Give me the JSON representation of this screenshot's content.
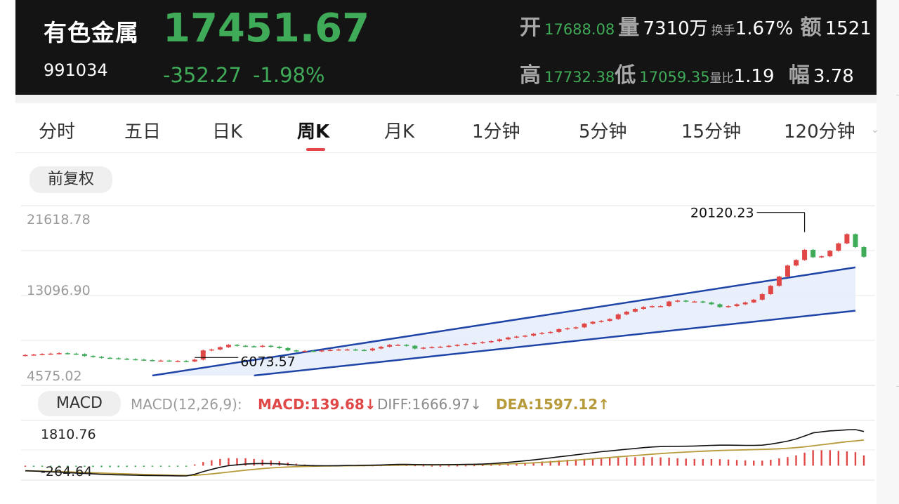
{
  "header": {
    "name": "有色金属",
    "code": "991034",
    "price": "17451.67",
    "change": "-352.27",
    "change_pct": "-1.98%",
    "open_label": "开",
    "open": "17688.08",
    "volume_label": "量",
    "volume": "7310万",
    "turnover_label": "换手",
    "turnover": "1.67%",
    "amount_label": "额",
    "amount": "1521",
    "high_label": "高",
    "high": "17732.38",
    "low_label": "低",
    "low": "17059.35",
    "vol_ratio_label": "量比",
    "vol_ratio": "1.19",
    "amplitude_label": "幅",
    "amplitude": "3.78"
  },
  "tabs": [
    "分时",
    "五日",
    "日K",
    "周K",
    "月K",
    "1分钟",
    "5分钟",
    "15分钟",
    "120分钟"
  ],
  "active_tab": "周K",
  "adjust_label": "前复权",
  "macd_panel": {
    "label": "MACD",
    "params": "MACD(12,26,9):",
    "macd": "MACD:139.68",
    "diff": "DIFF:1666.97",
    "dea": "DEA:1597.12",
    "y_top": "1810.76",
    "y_bottom": "-264.64"
  },
  "colors": {
    "up": "#e04848",
    "down": "#3faa58",
    "channel": "#1f44a8",
    "dea": "#b79a3a"
  },
  "chart_data": {
    "type": "candlestick",
    "yticks": [
      "21618.78",
      "13096.90",
      "4575.02"
    ],
    "ylim": [
      4575.02,
      21618.78
    ],
    "annotations": [
      {
        "label": "20120.23",
        "index": 92,
        "value": 20120.23
      },
      {
        "label": "6073.57",
        "index": 20,
        "value": 6073.57
      }
    ],
    "channel": {
      "upper": [
        {
          "index": 15,
          "value": 4575
        },
        {
          "index": 98,
          "value": 16300
        }
      ],
      "lower": [
        {
          "index": 27,
          "value": 4575
        },
        {
          "index": 98,
          "value": 11600
        }
      ]
    },
    "closes": [
      6800,
      6850,
      6900,
      6950,
      7000,
      6950,
      6900,
      6700,
      6600,
      6500,
      6450,
      6400,
      6350,
      6300,
      6250,
      6200,
      6200,
      6150,
      6150,
      6100,
      6300,
      7300,
      7400,
      7650,
      7900,
      7800,
      7750,
      7700,
      7800,
      7700,
      7550,
      7300,
      7200,
      7250,
      7200,
      7300,
      7350,
      7400,
      7400,
      7350,
      7300,
      7500,
      7700,
      7900,
      7900,
      7800,
      7500,
      7600,
      7650,
      7700,
      7800,
      7900,
      8000,
      8100,
      8200,
      8300,
      8500,
      8700,
      8800,
      8900,
      9100,
      9200,
      9300,
      9600,
      9700,
      9800,
      10200,
      10400,
      10500,
      10700,
      11200,
      11500,
      11800,
      12000,
      12100,
      12100,
      12600,
      12700,
      12600,
      12600,
      12500,
      12300,
      12000,
      12100,
      12300,
      12500,
      12800,
      13400,
      14300,
      15300,
      16500,
      17100,
      18200,
      17400,
      17500,
      18100,
      18900,
      19900,
      18500,
      17451
    ],
    "diff": [
      -250,
      -265,
      -280,
      -300,
      -320,
      -340,
      -360,
      -380,
      -400,
      -420,
      -440,
      -450,
      -455,
      -465,
      -475,
      -480,
      -485,
      -490,
      -495,
      -500,
      -420,
      -290,
      -180,
      -80,
      0,
      40,
      80,
      95,
      105,
      100,
      90,
      60,
      30,
      10,
      0,
      -5,
      -5,
      0,
      10,
      15,
      20,
      25,
      35,
      50,
      60,
      60,
      55,
      50,
      45,
      45,
      50,
      55,
      60,
      70,
      80,
      100,
      130,
      160,
      200,
      240,
      280,
      330,
      380,
      430,
      480,
      530,
      580,
      630,
      680,
      720,
      760,
      800,
      840,
      880,
      910,
      930,
      940,
      945,
      950,
      960,
      975,
      990,
      1000,
      1000,
      995,
      990,
      990,
      1000,
      1050,
      1120,
      1200,
      1300,
      1450,
      1600,
      1650,
      1700,
      1720,
      1750,
      1760,
      1667
    ],
    "dea": [
      -250,
      -258,
      -267,
      -278,
      -290,
      -303,
      -317,
      -331,
      -346,
      -361,
      -376,
      -391,
      -404,
      -416,
      -428,
      -440,
      -450,
      -459,
      -468,
      -476,
      -470,
      -440,
      -400,
      -355,
      -310,
      -265,
      -220,
      -180,
      -140,
      -110,
      -85,
      -65,
      -50,
      -38,
      -28,
      -20,
      -14,
      -10,
      -6,
      -2,
      2,
      6,
      12,
      18,
      25,
      30,
      34,
      37,
      39,
      40,
      42,
      44,
      47,
      50,
      55,
      62,
      72,
      85,
      100,
      118,
      138,
      160,
      185,
      212,
      240,
      270,
      300,
      332,
      365,
      398,
      430,
      463,
      495,
      528,
      560,
      590,
      617,
      642,
      665,
      686,
      705,
      722,
      738,
      752,
      764,
      775,
      785,
      795,
      808,
      825,
      850,
      880,
      920,
      970,
      1020,
      1070,
      1120,
      1170,
      1210,
      1250
    ]
  }
}
